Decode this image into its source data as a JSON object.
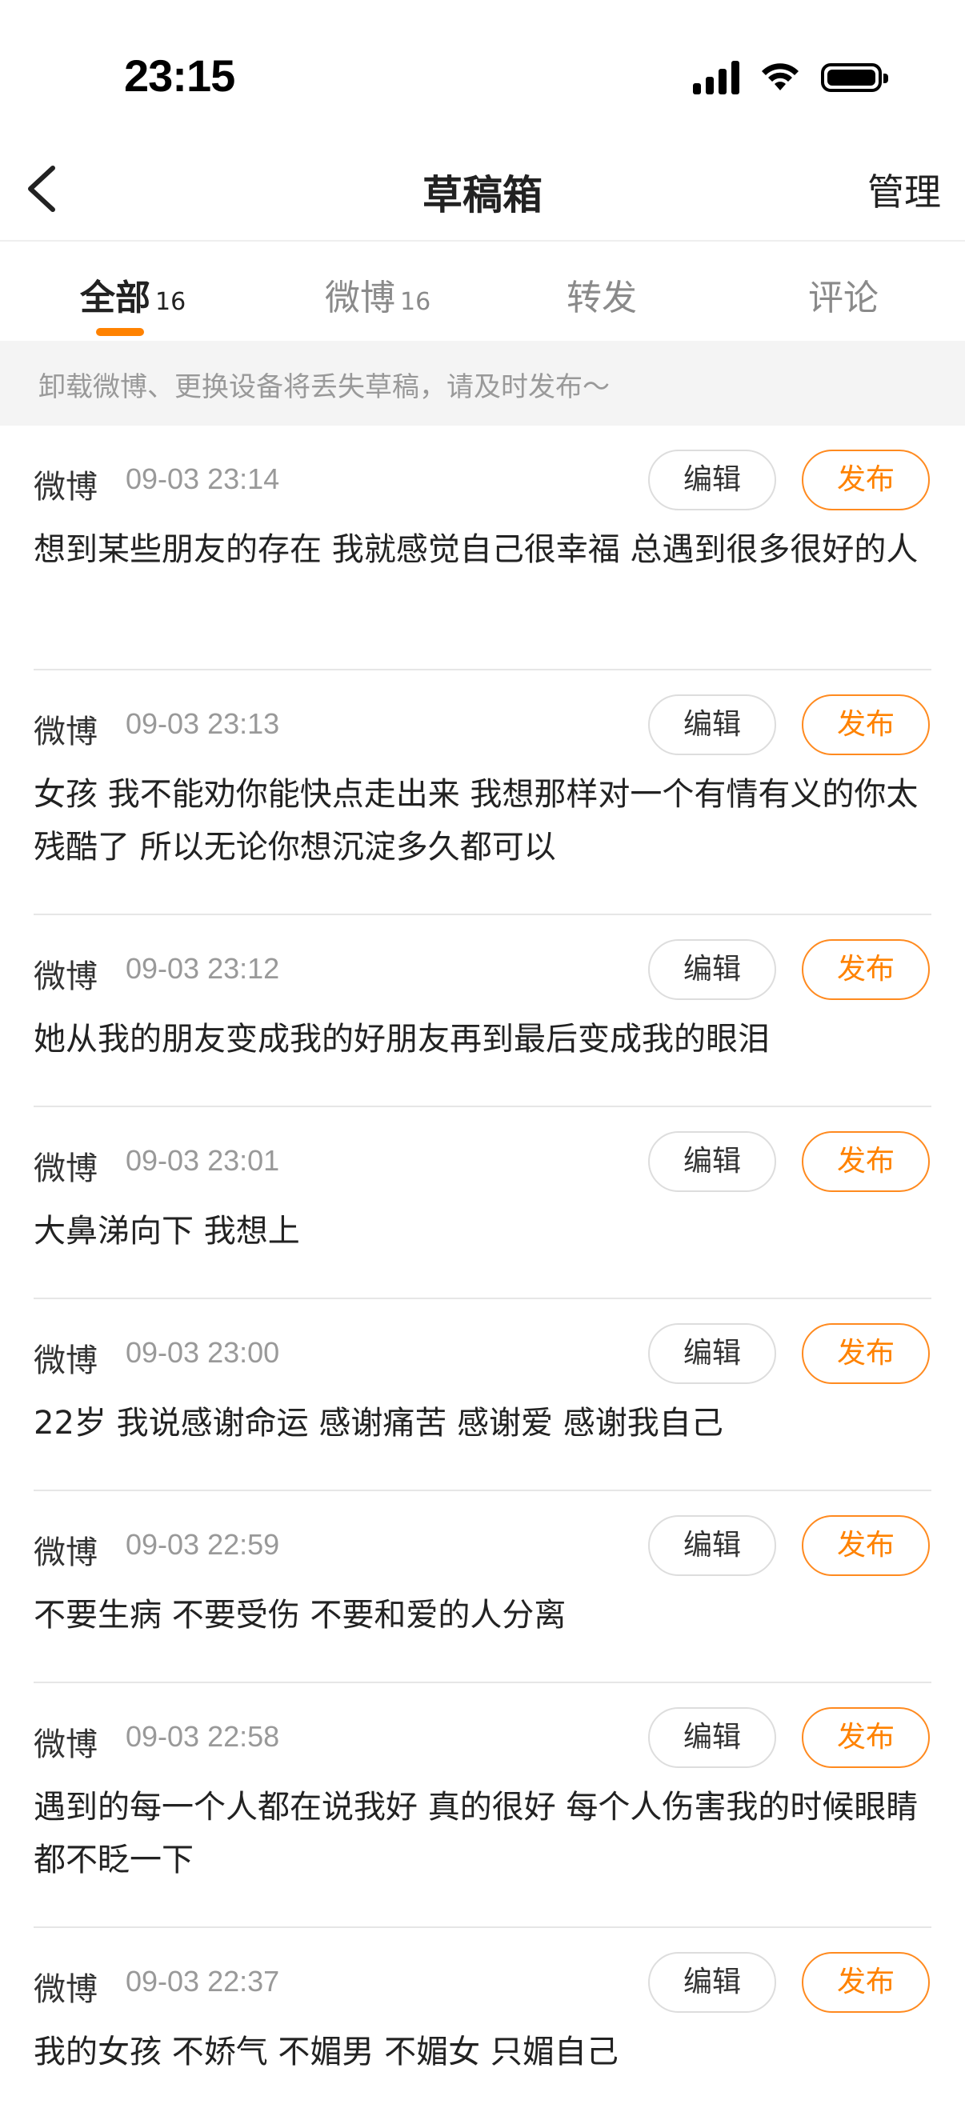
{
  "status_bar": {
    "time": "23:15"
  },
  "nav": {
    "title": "草稿箱",
    "manage_label": "管理"
  },
  "tabs": [
    {
      "label": "全部",
      "count": "16",
      "active": true
    },
    {
      "label": "微博",
      "count": "16",
      "active": false
    },
    {
      "label": "转发",
      "count": "",
      "active": false
    },
    {
      "label": "评论",
      "count": "",
      "active": false
    }
  ],
  "colors": {
    "accent": "#ff8200"
  },
  "notice": "卸载微博、更换设备将丢失草稿，请及时发布～",
  "buttons": {
    "edit_label": "编辑",
    "publish_label": "发布"
  },
  "drafts": [
    {
      "type": "微博",
      "time": "09-03 23:14",
      "content": "想到某些朋友的存在 我就感觉自己很幸福 总遇到很多很好的人"
    },
    {
      "type": "微博",
      "time": "09-03 23:13",
      "content": "女孩 我不能劝你能快点走出来 我想那样对一个有情有义的你太残酷了 所以无论你想沉淀多久都可以"
    },
    {
      "type": "微博",
      "time": "09-03 23:12",
      "content": "她从我的朋友变成我的好朋友再到最后变成我的眼泪"
    },
    {
      "type": "微博",
      "time": "09-03 23:01",
      "content": "大鼻涕向下 我想上"
    },
    {
      "type": "微博",
      "time": "09-03 23:00",
      "content": "22岁 我说感谢命运 感谢痛苦 感谢爱 感谢我自己"
    },
    {
      "type": "微博",
      "time": "09-03 22:59",
      "content": "不要生病 不要受伤 不要和爱的人分离"
    },
    {
      "type": "微博",
      "time": "09-03 22:58",
      "content": "遇到的每一个人都在说我好 真的很好 每个人伤害我的时候眼睛都不眨一下"
    },
    {
      "type": "微博",
      "time": "09-03 22:37",
      "content": "我的女孩 不娇气 不媚男 不媚女 只媚自己"
    }
  ]
}
